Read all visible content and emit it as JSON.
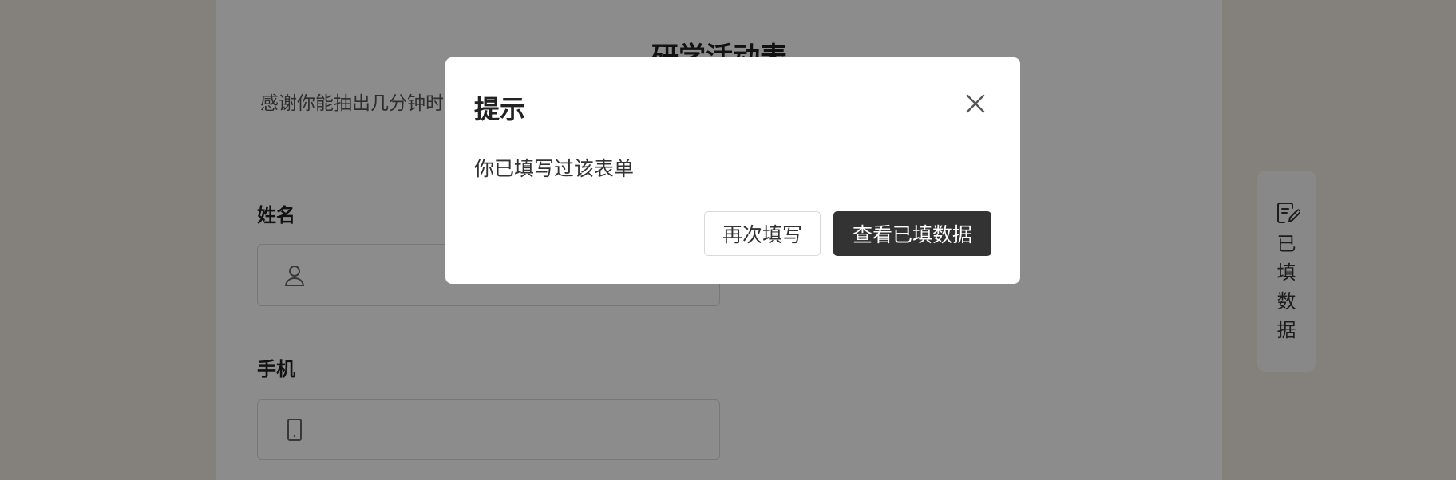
{
  "form": {
    "title": "研学活动表",
    "description": "感谢你能抽出几分钟时间来参加本次活动",
    "fields": [
      {
        "label": "姓名",
        "icon": "user-icon",
        "value": ""
      },
      {
        "label": "手机",
        "icon": "phone-icon",
        "value": ""
      }
    ]
  },
  "side_tab": {
    "icon": "edit-document-icon",
    "label": "已填数据"
  },
  "modal": {
    "title": "提示",
    "message": "你已填写过该表单",
    "close_icon": "close-icon",
    "refill_label": "再次填写",
    "view_label": "查看已填数据"
  },
  "colors": {
    "page_background": "#f0ebe2",
    "primary_button": "#333333",
    "overlay": "rgba(0,0,0,0.45)"
  }
}
